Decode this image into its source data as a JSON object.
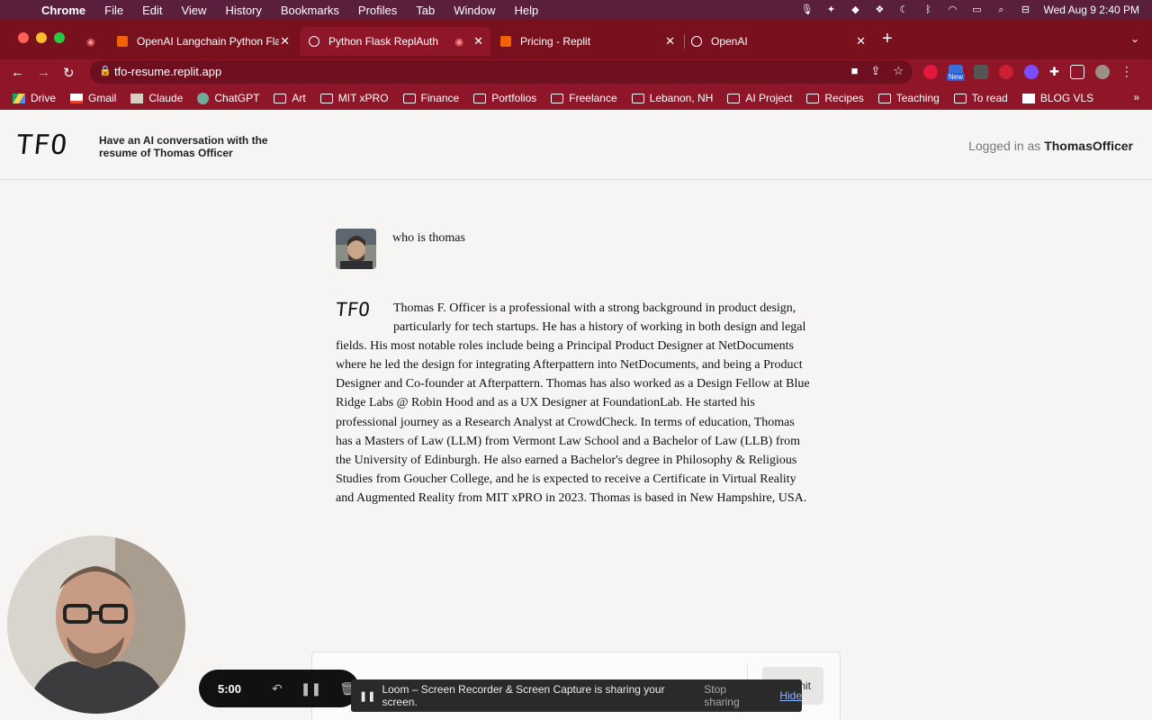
{
  "menubar": {
    "app": "Chrome",
    "items": [
      "File",
      "Edit",
      "View",
      "History",
      "Bookmarks",
      "Profiles",
      "Tab",
      "Window",
      "Help"
    ],
    "clock": "Wed Aug 9  2:40 PM"
  },
  "tabs": [
    {
      "title": "OpenAI Langchain Python Flask",
      "active": false
    },
    {
      "title": "Python Flask ReplAuth",
      "active": true
    },
    {
      "title": "Pricing - Replit",
      "active": false
    },
    {
      "title": "OpenAI",
      "active": false
    }
  ],
  "address": {
    "url": "tfo-resume.replit.app"
  },
  "bookmarks": [
    "Drive",
    "Gmail",
    "Claude",
    "ChatGPT",
    "Art",
    "MIT xPRO",
    "Finance",
    "Portfolios",
    "Freelance",
    "Lebanon, NH",
    "AI Project",
    "Recipes",
    "Teaching",
    "To read",
    "BLOG VLS"
  ],
  "extension_badge": "New",
  "header": {
    "logo": "TFO",
    "tagline": "Have an AI conversation with the resume of Thomas Officer",
    "login_prefix": "Logged in as",
    "username": "ThomasOfficer"
  },
  "chat": {
    "user_message": "who is thomas",
    "bot_logo": "TFO",
    "bot_message": "Thomas F. Officer is a professional with a strong background in product design, particularly for tech startups. He has a history of working in both design and legal fields. His most notable roles include being a Principal Product Designer at NetDocuments where he led the design for integrating Afterpattern into NetDocuments, and being a Product Designer and Co-founder at Afterpattern. Thomas has also worked as a Design Fellow at Blue Ridge Labs @ Robin Hood and as a UX Designer at FoundationLab. He started his professional journey as a Research Analyst at CrowdCheck. In terms of education, Thomas has a Masters of Law (LLM) from Vermont Law School and a Bachelor of Law (LLB) from the University of Edinburgh. He also earned a Bachelor's degree in Philosophy & Religious Studies from Goucher College, and he is expected to receive a Certificate in Virtual Reality and Augmented Reality from MIT xPRO in 2023. Thomas is based in New Hampshire, USA."
  },
  "input": {
    "submit_label": "mit"
  },
  "loom": {
    "timer": "5:00",
    "share_text": "Loom – Screen Recorder & Screen Capture is sharing your screen.",
    "stop_label": "Stop sharing",
    "hide_label": "Hide"
  }
}
